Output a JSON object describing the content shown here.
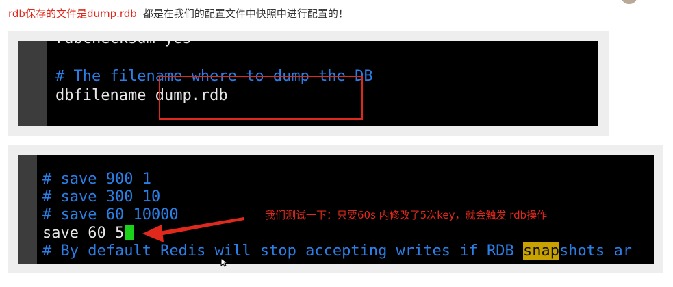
{
  "heading": {
    "red_text": "rdb保存的文件是dump.rdb",
    "dark_text": "都是在我们的配置文件中快照中进行配置的！"
  },
  "terminal1": {
    "cut_line": "rdbchecksum yes",
    "comment_line": "# The filename where to dump the DB",
    "config_key": "dbfilename",
    "config_value": "dump.rdb"
  },
  "terminal2": {
    "lines": [
      "# save 900 1",
      "# save 300 10",
      "# save 60 10000",
      "save 60 5"
    ],
    "last_line_prefix": "# By default Redis will stop accepting writes if RDB ",
    "last_line_highlight": "snap",
    "last_line_suffix": "shots ar"
  },
  "annotation": {
    "text": "我们测试一下：只要60s 内修改了5次key，就会触发 rdb操作"
  },
  "colors": {
    "accent_red": "#e0291c",
    "comment_blue": "#2a7fe6",
    "cursor_green": "#1bd21b",
    "search_highlight": "#c9a200"
  },
  "icons": {
    "mouse_pointer": "mouse-pointer-icon",
    "avatar": "avatar"
  }
}
